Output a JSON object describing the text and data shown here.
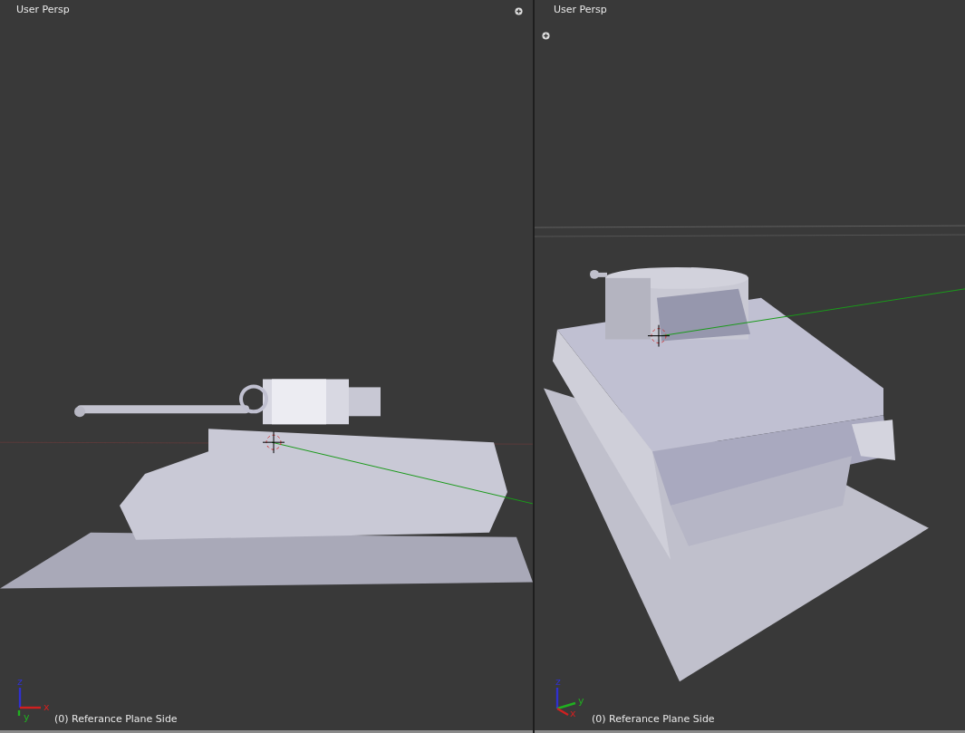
{
  "viewports": [
    {
      "kind": "side",
      "view_label": "User Persp",
      "object_label": "(0) Referance Plane Side",
      "axes": [
        {
          "label": "z",
          "color": "#3030d0"
        },
        {
          "label": "y",
          "color": "#20b020"
        },
        {
          "label": "x",
          "color": "#d02020"
        }
      ]
    },
    {
      "kind": "persp",
      "view_label": "User Persp",
      "object_label": "(0) Referance Plane Side",
      "axes": [
        {
          "label": "z",
          "color": "#3030d0"
        },
        {
          "label": "y",
          "color": "#20b020"
        },
        {
          "label": "x",
          "color": "#d02020"
        }
      ]
    }
  ]
}
